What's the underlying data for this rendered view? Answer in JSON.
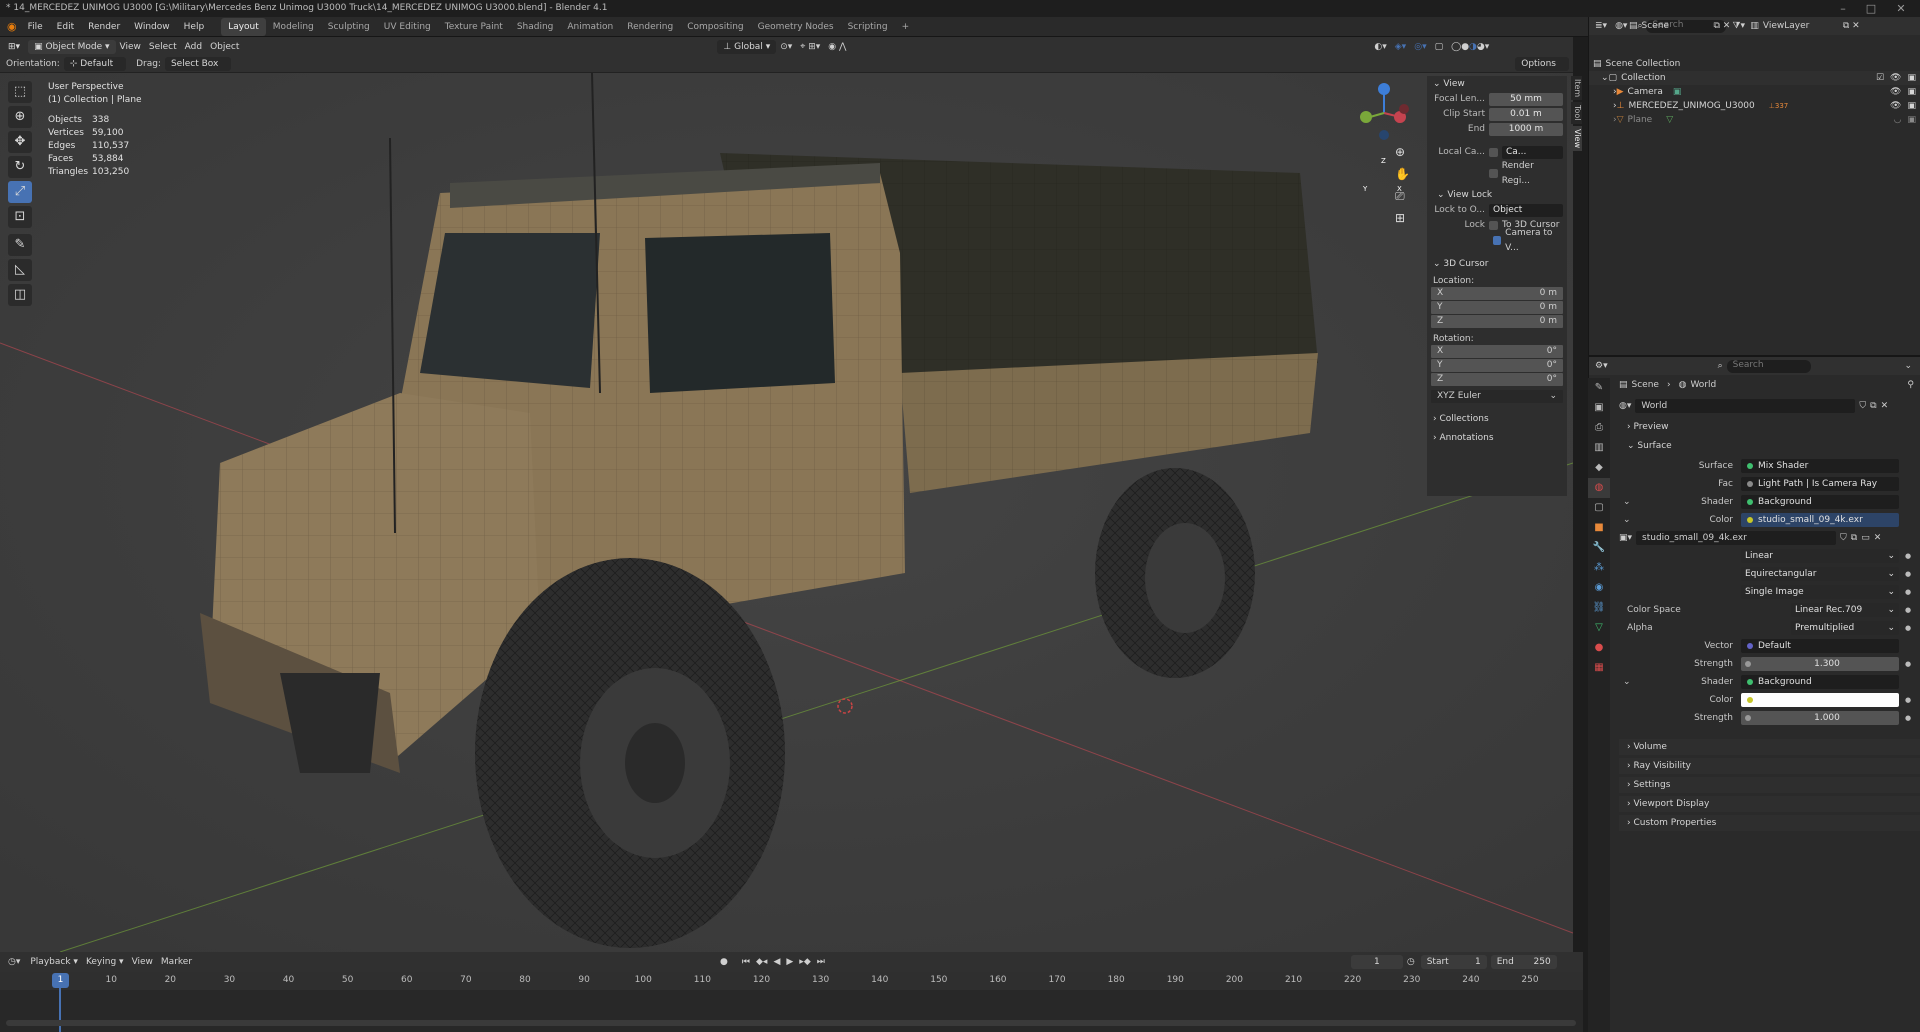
{
  "window": {
    "title": "* 14_MERCEDEZ UNIMOG U3000 [G:\\Military\\Mercedes Benz Unimog U3000 Truck\\14_MERCEDEZ UNIMOG U3000.blend] - Blender 4.1",
    "minimize": "–",
    "maximize": "□",
    "close": "✕"
  },
  "menu": {
    "items": [
      "File",
      "Edit",
      "Render",
      "Window",
      "Help"
    ]
  },
  "workspaces": [
    "Layout",
    "Modeling",
    "Sculpting",
    "UV Editing",
    "Texture Paint",
    "Shading",
    "Animation",
    "Rendering",
    "Compositing",
    "Geometry Nodes",
    "Scripting",
    "+"
  ],
  "header": {
    "mode": "Object Mode",
    "view": "View",
    "select": "Select",
    "add": "Add",
    "object": "Object",
    "transform": "Global",
    "orientation_label": "Orientation:",
    "orientation": "Default",
    "drag_label": "Drag:",
    "drag": "Select Box",
    "options": "Options"
  },
  "overlay": {
    "perspective": "User Perspective",
    "collection": "(1) Collection | Plane",
    "stats": [
      {
        "label": "Objects",
        "value": "338"
      },
      {
        "label": "Vertices",
        "value": "59,100"
      },
      {
        "label": "Edges",
        "value": "110,537"
      },
      {
        "label": "Faces",
        "value": "53,884"
      },
      {
        "label": "Triangles",
        "value": "103,250"
      }
    ]
  },
  "gizmo": {
    "x": "X",
    "y": "Y",
    "z": "Z"
  },
  "npanel": {
    "view_title": "View",
    "focal_label": "Focal Len...",
    "focal": "50 mm",
    "clip_start_label": "Clip Start",
    "clip_start": "0.01 m",
    "end_label": "End",
    "end": "1000 m",
    "local_cam_label": "Local Ca...",
    "local_cam": "Ca...",
    "render_region": "Render Regi...",
    "view_lock": "View Lock",
    "lock_obj_label": "Lock to O...",
    "lock_obj": "Object",
    "lock_label": "Lock",
    "to_cursor": "To 3D Cursor",
    "cam_to_view": "Camera to V...",
    "cursor_title": "3D Cursor",
    "location_label": "Location:",
    "loc": [
      {
        "a": "X",
        "v": "0 m"
      },
      {
        "a": "Y",
        "v": "0 m"
      },
      {
        "a": "Z",
        "v": "0 m"
      }
    ],
    "rotation_label": "Rotation:",
    "rot": [
      {
        "a": "X",
        "v": "0°"
      },
      {
        "a": "Y",
        "v": "0°"
      },
      {
        "a": "Z",
        "v": "0°"
      }
    ],
    "euler": "XYZ Euler",
    "collections": "Collections",
    "annotations": "Annotations",
    "tabs": [
      "Item",
      "Tool",
      "View"
    ]
  },
  "outliner": {
    "scene": "Scene",
    "viewlayer": "ViewLayer",
    "search": "Search",
    "scene_collection": "Scene Collection",
    "collection": "Collection",
    "camera": "Camera",
    "truck": "MERCEDEZ_UNIMOG_U3000",
    "truck_badge": "337",
    "plane": "Plane"
  },
  "properties": {
    "search": "Search",
    "crumb_scene": "Scene",
    "crumb_world": "World",
    "world_name": "World",
    "preview": "Preview",
    "surface": "Surface",
    "rows": [
      {
        "label": "Surface",
        "value": "Mix Shader",
        "dot": "#3fbf6f"
      },
      {
        "label": "Fac",
        "value": "Light Path | Is Camera Ray",
        "dot": "#8a8a8a"
      },
      {
        "label": "Shader",
        "value": "Background",
        "dot": "#3fbf6f"
      },
      {
        "label": "Color",
        "value": "studio_small_09_4k.exr",
        "dot": "#c7c729"
      }
    ],
    "image_name": "studio_small_09_4k.exr",
    "interp": "Linear",
    "proj": "Equirectangular",
    "source": "Single Image",
    "colorspace_label": "Color Space",
    "colorspace": "Linear Rec.709",
    "alpha_label": "Alpha",
    "alpha": "Premultiplied",
    "vector_label": "Vector",
    "vector": "Default",
    "strength_label": "Strength",
    "strength1": "1.300",
    "shader2_label": "Shader",
    "shader2": "Background",
    "color2_label": "Color",
    "strength2": "1.000",
    "closed": [
      "Volume",
      "Ray Visibility",
      "Settings",
      "Viewport Display",
      "Custom Properties"
    ]
  },
  "timeline": {
    "playback": "Playback",
    "keying": "Keying",
    "view": "View",
    "marker": "Marker",
    "frame": "1",
    "start_label": "Start",
    "start": "1",
    "end_label": "End",
    "end": "250",
    "ticks": [
      "1",
      "10",
      "20",
      "30",
      "40",
      "50",
      "60",
      "70",
      "80",
      "90",
      "100",
      "110",
      "120",
      "130",
      "140",
      "150",
      "160",
      "170",
      "180",
      "190",
      "200",
      "210",
      "220",
      "230",
      "240",
      "250"
    ]
  },
  "colors": {
    "accent": "#4772b3",
    "viewport": "#3d3d3d",
    "axis_x": "#c6434f",
    "axis_y": "#7aa83a",
    "axis_z": "#3d7ed8"
  }
}
